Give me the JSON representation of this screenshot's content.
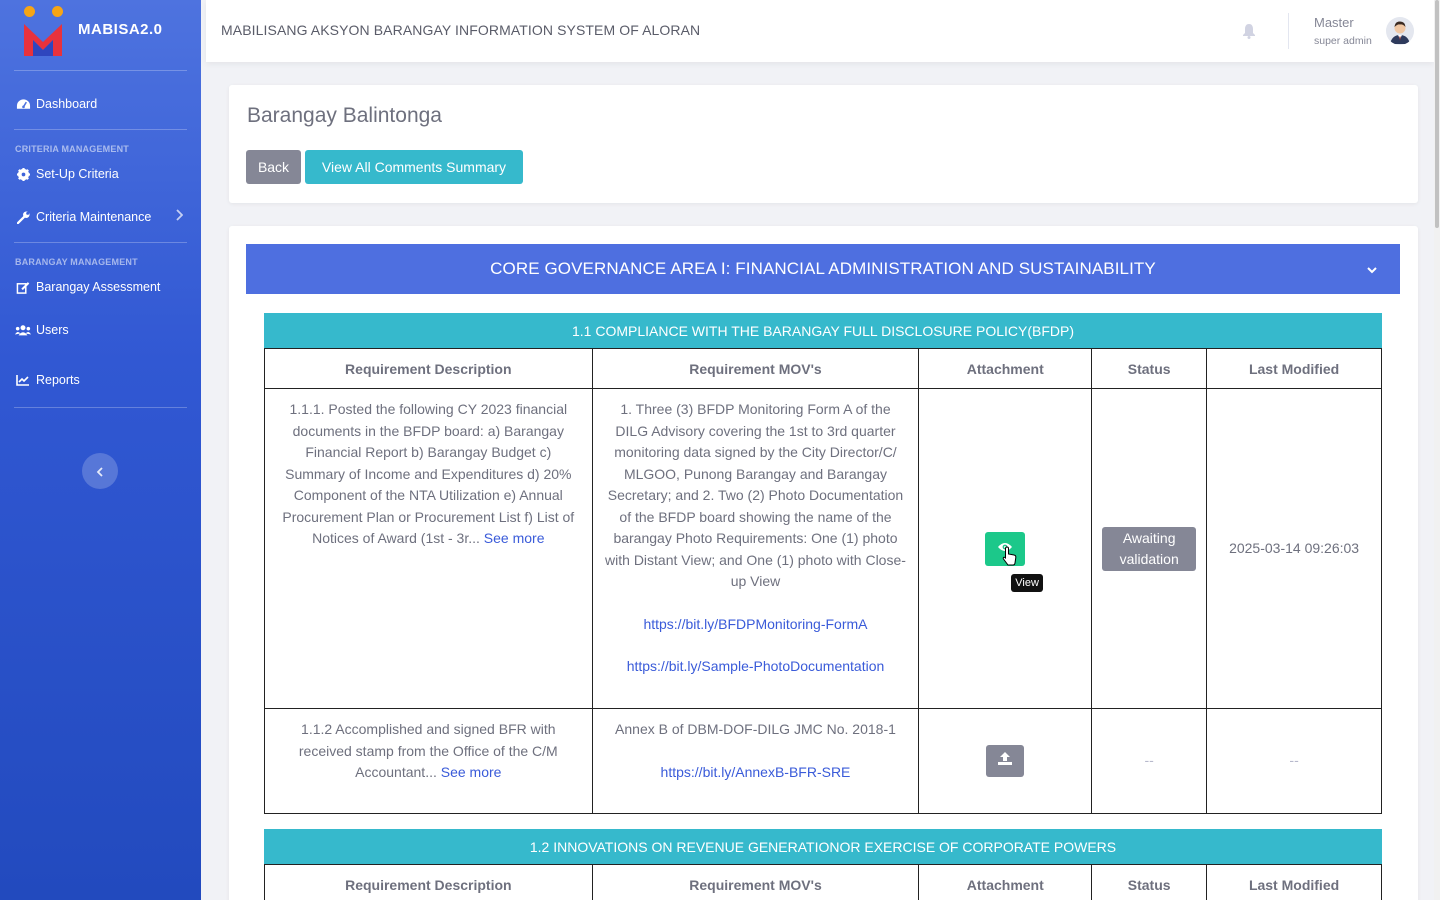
{
  "app": {
    "brand": "MABISA2.0",
    "system_title": "MABILISANG AKSYON BARANGAY INFORMATION SYSTEM OF ALORAN"
  },
  "sidebar": {
    "dashboard": "Dashboard",
    "heading_criteria": "CRITERIA MANAGEMENT",
    "setup_criteria": "Set-Up Criteria",
    "criteria_maintenance": "Criteria Maintenance",
    "heading_barangay": "BARANGAY MANAGEMENT",
    "barangay_assessment": "Barangay Assessment",
    "users": "Users",
    "reports": "Reports"
  },
  "user": {
    "name": "Master",
    "role": "super admin"
  },
  "page": {
    "title": "Barangay Balintonga",
    "back_label": "Back",
    "comments_label": "View All Comments Summary"
  },
  "area": {
    "title": "CORE GOVERNANCE AREA I: FINANCIAL ADMINISTRATION AND SUSTAINABILITY"
  },
  "columns": {
    "desc": "Requirement Description",
    "movs": "Requirement MOV's",
    "attachment": "Attachment",
    "status": "Status",
    "modified": "Last Modified"
  },
  "sections": [
    {
      "title": "1.1 COMPLIANCE WITH THE BARANGAY FULL DISCLOSURE POLICY(BFDP)",
      "rows": [
        {
          "description": "1.1.1. Posted the following CY 2023 financial documents in the BFDP board: a) Barangay Financial Report b) Barangay Budget c) Summary of Income and Expenditures d) 20% Component of the NTA Utilization e) Annual Procurement Plan or Procurement List f) List of Notices of Award (1st - 3r...",
          "see_more": "See more",
          "movs_text": "1. Three (3) BFDP Monitoring Form A of the DILG Advisory covering the 1st to 3rd quarter monitoring data signed by the City Director/C/ MLGOO, Punong Barangay and Barangay Secretary; and 2. Two (2) Photo Documentation of the BFDP board showing the name of the barangay Photo Requirements: One (1) photo with Distant View; and One (1) photo with Close-up View",
          "link1": "https://bit.ly/BFDPMonitoring-FormA",
          "link2": "https://bit.ly/Sample-PhotoDocumentation",
          "attachment_tooltip": "View",
          "status": "Awaiting validation",
          "last_modified": "2025-03-14 09:26:03"
        },
        {
          "description": "1.1.2 Accomplished and signed BFR with received stamp from the Office of the C/M Accountant...",
          "see_more": "See more",
          "movs_text": "Annex B of DBM-DOF-DILG JMC No. 2018-1",
          "link1": "https://bit.ly/AnnexB-BFR-SRE",
          "status": "--",
          "last_modified": "--"
        }
      ]
    },
    {
      "title": "1.2 INNOVATIONS ON REVENUE GENERATIONOR EXERCISE OF CORPORATE POWERS"
    }
  ],
  "colors": {
    "sidebar": "#4e73df",
    "area_header": "#4e6fe0",
    "section_header": "#36b9cc",
    "view_button": "#1cc88a",
    "secondary": "#858796"
  },
  "icons": [
    "tachometer-icon",
    "gear-icon",
    "wrench-icon",
    "edit-icon",
    "users-icon",
    "chart-line-icon",
    "chevron-right-icon",
    "chevron-left-icon",
    "bell-icon",
    "avatar",
    "chevron-down-icon",
    "eye-icon",
    "upload-icon",
    "pointer-cursor-icon"
  ]
}
